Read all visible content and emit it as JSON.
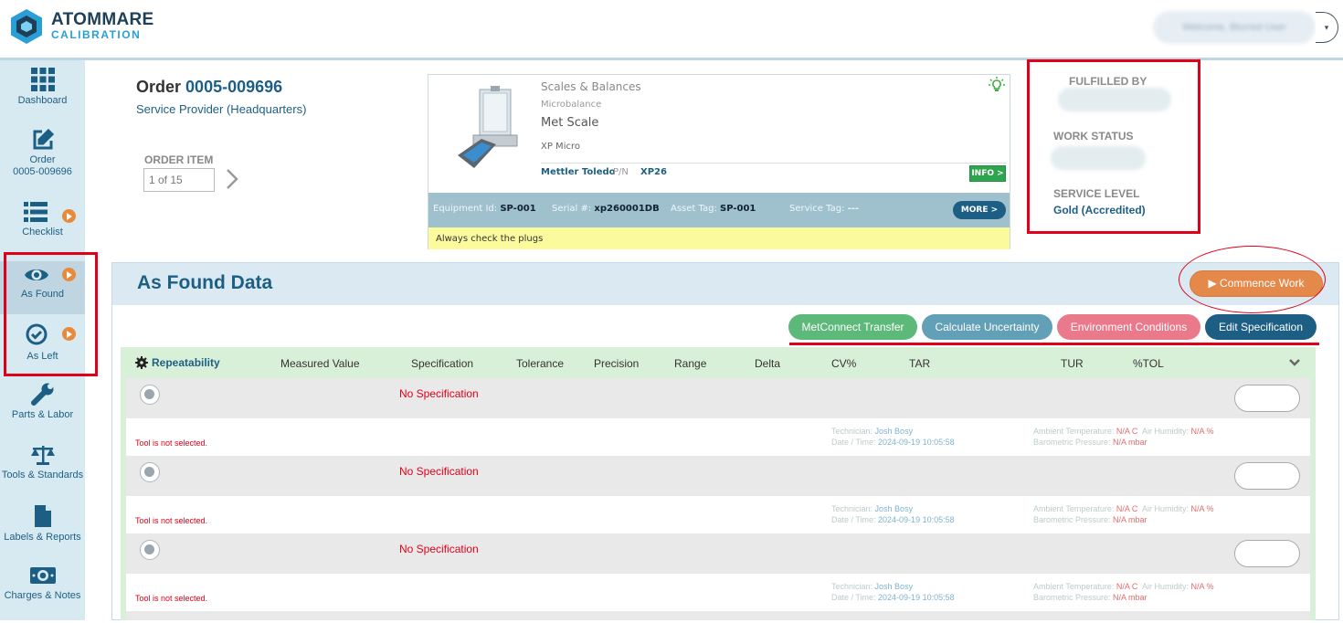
{
  "brand": {
    "name": "ATOMMARE",
    "sub": "CALIBRATION"
  },
  "user": {
    "greeting": "Welcome, Blurred User"
  },
  "sidebar": {
    "items": [
      {
        "label": "Dashboard"
      },
      {
        "label": "Order",
        "sub": "0005-009696"
      },
      {
        "label": "Checklist"
      },
      {
        "label": "As Found"
      },
      {
        "label": "As Left"
      },
      {
        "label": "Parts & Labor"
      },
      {
        "label": "Tools & Standards"
      },
      {
        "label": "Labels & Reports"
      },
      {
        "label": "Charges & Notes"
      }
    ]
  },
  "order": {
    "prefix": "Order",
    "number": "0005-009696",
    "provider": "Service Provider (Headquarters)",
    "item_label": "ORDER ITEM",
    "item_value": "1 of 15"
  },
  "equipment": {
    "category": "Scales & Balances",
    "subcategory": "Microbalance",
    "name": "Met Scale",
    "model": "XP Micro",
    "manufacturer": "Mettler Toledo",
    "pn_label": "P/N",
    "pn": "XP26",
    "info_label": "INFO >",
    "equipment_id_label": "Equipment Id:",
    "equipment_id": "SP-001",
    "serial_label": "Serial #:",
    "serial": "xp260001DB",
    "asset_label": "Asset Tag:",
    "asset": "SP-001",
    "service_label": "Service Tag:",
    "service": "---",
    "more_label": "MORE >",
    "note": "Always check the plugs"
  },
  "status": {
    "fulfilled_label": "FULFILLED BY",
    "work_label": "WORK STATUS",
    "service_label": "SERVICE LEVEL",
    "service_value": "Gold (Accredited)"
  },
  "panel": {
    "title": "As Found Data",
    "commence": "Commence Work",
    "buttons": {
      "metconnect": "MetConnect Transfer",
      "uncertainty": "Calculate Uncertainty",
      "environment": "Environment Conditions",
      "edit_spec": "Edit Specification"
    }
  },
  "colors": {
    "green": "#5cb97a",
    "teal": "#61a0b6",
    "pink": "#ea7a8b",
    "navy": "#1d5f84",
    "orange": "#e5894a"
  },
  "table": {
    "section": "Repeatability",
    "headers": [
      "Measured Value",
      "Specification",
      "Tolerance",
      "Precision",
      "Range",
      "Delta",
      "CV%",
      "TAR",
      "TUR",
      "%TOL"
    ],
    "rows": [
      {
        "spec": "No Specification",
        "tool": "Tool is not selected.",
        "tech_label": "Technician:",
        "tech": "Josh Bosy",
        "date_label": "Date / Time:",
        "date": "2024-09-19 10:05:58",
        "temp_label": "Ambient Temperature:",
        "temp": "N/A C",
        "hum_label": "Air Humidity:",
        "hum": "N/A %",
        "baro_label": "Barometric Pressure:",
        "baro": "N/A mbar"
      },
      {
        "spec": "No Specification",
        "tool": "Tool is not selected.",
        "tech_label": "Technician:",
        "tech": "Josh Bosy",
        "date_label": "Date / Time:",
        "date": "2024-09-19 10:05:58",
        "temp_label": "Ambient Temperature:",
        "temp": "N/A C",
        "hum_label": "Air Humidity:",
        "hum": "N/A %",
        "baro_label": "Barometric Pressure:",
        "baro": "N/A mbar"
      },
      {
        "spec": "No Specification",
        "tool": "Tool is not selected.",
        "tech_label": "Technician:",
        "tech": "Josh Bosy",
        "date_label": "Date / Time:",
        "date": "2024-09-19 10:05:58",
        "temp_label": "Ambient Temperature:",
        "temp": "N/A C",
        "hum_label": "Air Humidity:",
        "hum": "N/A %",
        "baro_label": "Barometric Pressure:",
        "baro": "N/A mbar"
      }
    ]
  }
}
